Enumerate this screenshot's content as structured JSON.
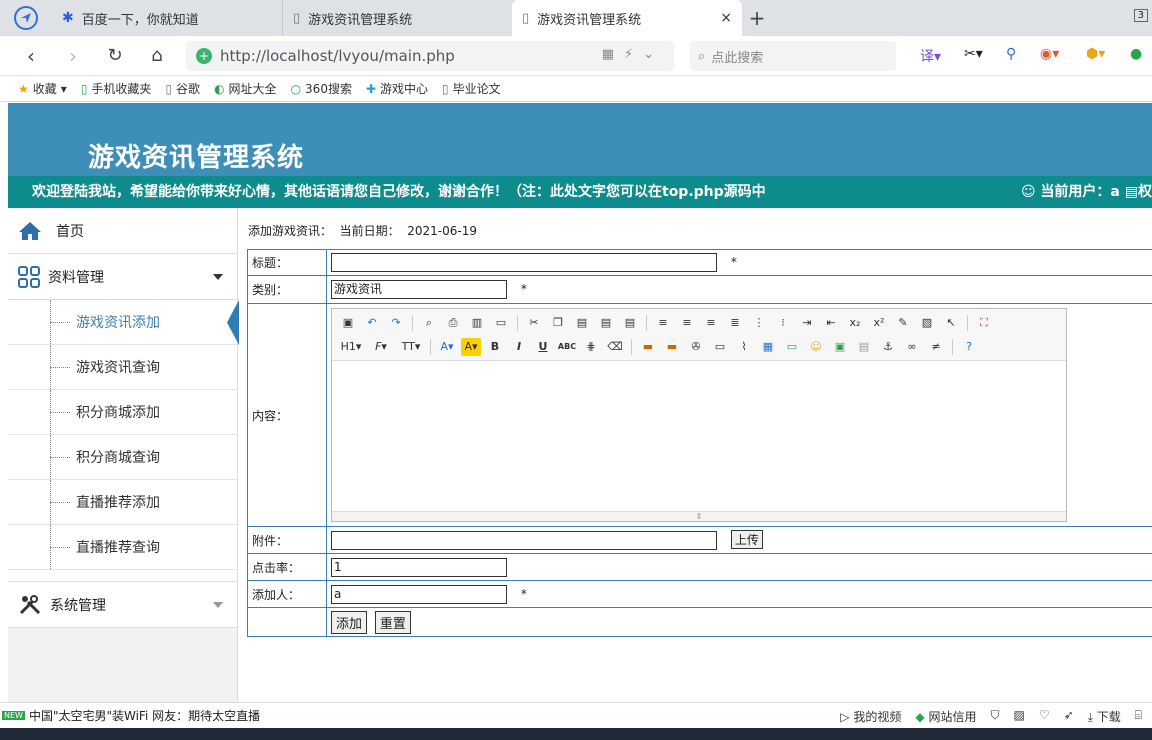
{
  "browser": {
    "tabs": [
      {
        "label": "百度一下，你就知道",
        "icon": "baidu-paw-icon"
      },
      {
        "label": "游戏资讯管理系统",
        "icon": "page-icon"
      },
      {
        "label": "游戏资讯管理系统",
        "icon": "page-icon",
        "active": true
      }
    ],
    "tab_close": "×",
    "new_tab": "+",
    "tab_count": "3",
    "url": "http://localhost/lvyou/main.php",
    "search_placeholder": "点此搜索",
    "bookmarks": [
      {
        "label": "收藏",
        "icon": "star-icon"
      },
      {
        "label": "手机收藏夹",
        "icon": "phone-icon"
      },
      {
        "label": "谷歌",
        "icon": "page-icon"
      },
      {
        "label": "网址大全",
        "icon": "compass-icon"
      },
      {
        "label": "360搜索",
        "icon": "search-icon"
      },
      {
        "label": "游戏中心",
        "icon": "gamepad-icon"
      },
      {
        "label": "毕业论文",
        "icon": "page-icon"
      }
    ],
    "status_news_badge": "NEW",
    "status_news": "中国\"太空宅男\"装WiFi 网友：期待太空直播",
    "status_right": [
      "我的视频",
      "网站信用",
      "下载"
    ]
  },
  "header": {
    "title": "游戏资讯管理系统",
    "marquee": "欢迎登陆我站，希望能给你带来好心情，其他话语请您自己修改，谢谢合作！（注：此处文字您可以在top.php源码中",
    "user_label": "当前用户：a",
    "user_extra": "权"
  },
  "sidebar": {
    "home": "首页",
    "group1": "资料管理",
    "items": [
      "游戏资讯添加",
      "游戏资讯查询",
      "积分商城添加",
      "积分商城查询",
      "直播推荐添加",
      "直播推荐查询"
    ],
    "active_index": 0,
    "group2": "系统管理"
  },
  "form": {
    "caption": "添加游戏资讯：  当前日期：  2021-06-19",
    "fields": {
      "title_label": "标题：",
      "title_value": "",
      "category_label": "类别：",
      "category_value": "游戏资讯",
      "content_label": "内容：",
      "attachment_label": "附件：",
      "attachment_value": "",
      "upload_button": "上传",
      "clicks_label": "点击率：",
      "clicks_value": "1",
      "adder_label": "添加人：",
      "adder_value": "a",
      "required_mark": "*"
    },
    "submit_button": "添加",
    "reset_button": "重置"
  },
  "editor": {
    "toolbar_row1": [
      "source-icon",
      "undo-icon",
      "redo-icon",
      "preview-icon",
      "print-icon",
      "template-icon",
      "code-icon",
      "cut-icon",
      "copy-icon",
      "paste-icon",
      "paste-text-icon",
      "paste-word-icon",
      "align-left-icon",
      "align-center-icon",
      "align-right-icon",
      "justify-icon",
      "ordered-list-icon",
      "unordered-list-icon",
      "indent-icon",
      "outdent-icon",
      "subscript-icon",
      "superscript-icon",
      "clear-format-icon",
      "select-all-icon",
      "select-icon",
      "fullscreen-icon"
    ],
    "toolbar_row2_labels": {
      "heading": "H1",
      "font": "F",
      "size": "TT",
      "bold": "B",
      "italic": "I",
      "underline": "U",
      "strike": "ABC"
    }
  }
}
